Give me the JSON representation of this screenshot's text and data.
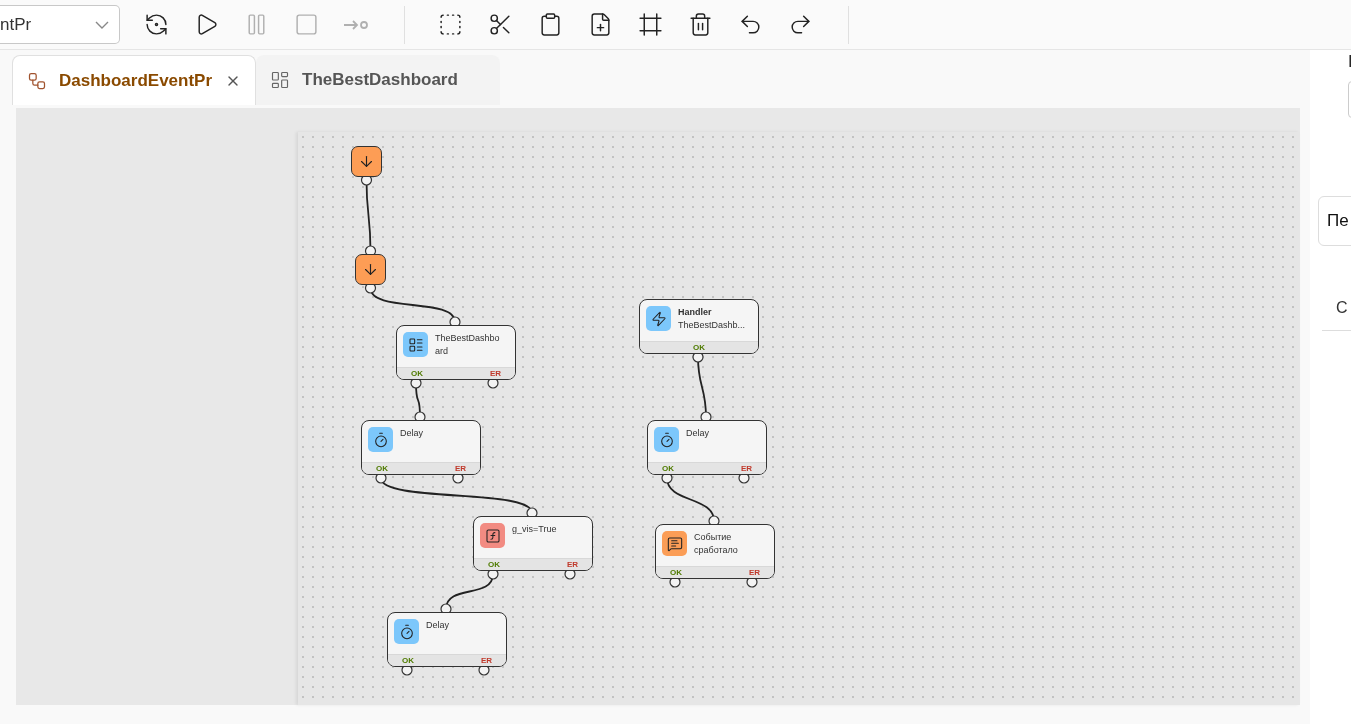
{
  "toolbar": {
    "select": {
      "value": "ntPr"
    },
    "groups": [
      [
        {
          "kind": "run-check",
          "disabled": false
        },
        {
          "kind": "play",
          "disabled": false
        },
        {
          "kind": "pause",
          "disabled": true
        },
        {
          "kind": "stop",
          "disabled": true
        },
        {
          "kind": "step",
          "disabled": true
        }
      ],
      [
        {
          "kind": "select-area",
          "disabled": false
        },
        {
          "kind": "cut",
          "disabled": false
        },
        {
          "kind": "paste",
          "disabled": false
        },
        {
          "kind": "add",
          "disabled": false
        },
        {
          "kind": "frame",
          "disabled": false
        },
        {
          "kind": "delete",
          "disabled": false
        },
        {
          "kind": "undo",
          "disabled": false
        },
        {
          "kind": "redo",
          "disabled": false
        }
      ]
    ]
  },
  "tabs": [
    {
      "kind": "process",
      "label": "DashboardEventPr",
      "selected": true
    },
    {
      "kind": "dashboard",
      "label": "TheBestDashboard",
      "selected": false
    }
  ],
  "nodes": [
    {
      "kind": "start"
    },
    {
      "kind": "start"
    },
    {
      "kind": "action",
      "color": "#7cc7fb",
      "title": "TheBestDashboard",
      "ports": [
        "OK",
        "ER"
      ]
    },
    {
      "kind": "action",
      "color": "#7cc7fb",
      "title": "Delay",
      "ports": [
        "OK",
        "ER"
      ]
    },
    {
      "kind": "action",
      "color": "#f28b82",
      "title": "g_vis=True",
      "ports": [
        "OK",
        "ER"
      ]
    },
    {
      "kind": "action",
      "color": "#7cc7fb",
      "title": "Delay",
      "ports": [
        "OK",
        "ER"
      ]
    },
    {
      "kind": "handler",
      "color": "#7cc7fb",
      "title": "Handler",
      "subtitle": "TheBestDashb...",
      "ports": [
        "OK"
      ]
    },
    {
      "kind": "action",
      "color": "#7cc7fb",
      "title": "Delay",
      "ports": [
        "OK",
        "ER"
      ]
    },
    {
      "kind": "action",
      "color": "#fb9d56",
      "title": "Событие сработало",
      "ports": [
        "OK",
        "ER"
      ]
    }
  ],
  "side_panel": {
    "label": "I",
    "tab": "Пе",
    "heading": "С"
  }
}
